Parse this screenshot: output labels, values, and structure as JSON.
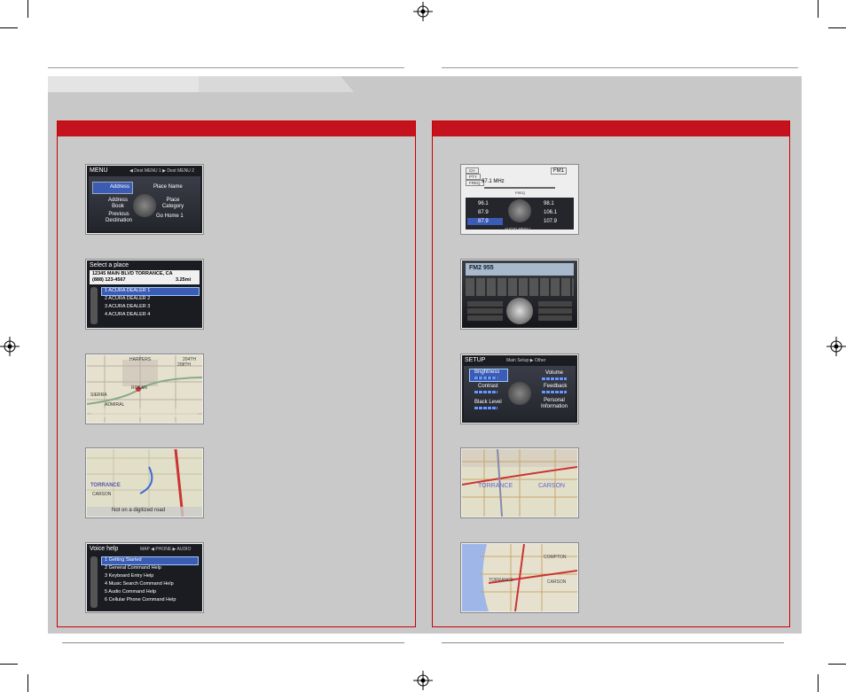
{
  "colors": {
    "accent": "#c4121f",
    "band": "#c8c8c8",
    "screen_bg": "#1a1c22",
    "highlight": "#3b5bb5"
  },
  "nav_menu": {
    "title": "MENU",
    "tabs": "◀ Dest MENU 1 ▶ Dest MENU 2",
    "items": [
      "Address",
      "Place Name",
      "Address Book",
      "Place Category",
      "Previous Destination",
      "Go Home 1"
    ]
  },
  "select_place": {
    "title": "Select a place",
    "address": "12345 MAIN BLVD TORRANCE, CA",
    "phone": "(888) 123-4567",
    "distance": "3.25mi",
    "dealers": [
      "1 ACURA DEALER 1",
      "2 ACURA DEALER 2",
      "3 ACURA DEALER 3",
      "4 ACURA DEALER 4"
    ]
  },
  "map1": {
    "labels": [
      "HARPERS",
      "204TH",
      "208TH",
      "ROSAN",
      "SIERRA",
      "ADMIRAL"
    ]
  },
  "map2": {
    "labels": [
      "TORRANCE",
      "CARSON",
      "Not on a digitized road"
    ]
  },
  "voice_help": {
    "title": "Voice help",
    "tabs": "MAP ◀ PHONE ▶ AUDIO",
    "items": [
      "1 Getting Started",
      "2 General Command Help",
      "3 Keyboard Entry Help",
      "4 Music Search Command Help",
      "5 Audio Command Help",
      "6 Cellular Phone Command Help"
    ]
  },
  "audio_screen": {
    "top_tags": [
      "CH",
      "PTY",
      "FREQ"
    ],
    "band": "FM1",
    "freq": "97.1 MHz",
    "presets": [
      "96.1",
      "98.1",
      "87.9",
      "106.1",
      "87.9",
      "107.9"
    ],
    "label_bottom": "AUDIO MENU",
    "label_top": "FREQ"
  },
  "console": {
    "display": "FM2  955"
  },
  "setup": {
    "title": "SETUP",
    "tabs": "Main Setup ▶ Other",
    "items": [
      "Brightness",
      "Volume",
      "Contrast",
      "Feedback",
      "Black Level",
      "Personal Information"
    ]
  },
  "map3": {
    "labels": [
      "TORRANCE",
      "CARSON"
    ]
  },
  "map4": {
    "labels": [
      "TORRANCE",
      "COMPTON",
      "CARSON"
    ]
  }
}
